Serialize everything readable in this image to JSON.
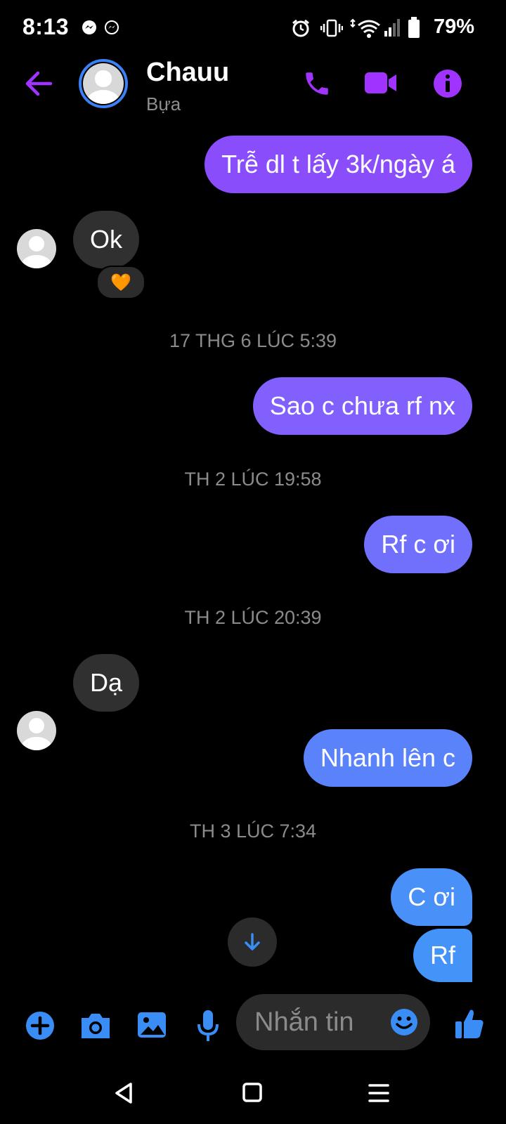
{
  "status_bar": {
    "time": "8:13",
    "battery": "79%"
  },
  "header": {
    "contact_name": "Chauu",
    "subtitle": "Bựa"
  },
  "messages": [
    {
      "dir": "out",
      "text": "Trễ dl t lấy 3k/ngày á",
      "color": "#8a4dfc"
    },
    {
      "dir": "in",
      "text": "Ok",
      "reaction": "🧡"
    },
    {
      "dir": "out",
      "text": "Sao c chưa rf nx",
      "color": "#8160fd"
    },
    {
      "dir": "out",
      "text": "Rf c ơi",
      "color": "#7070fd"
    },
    {
      "dir": "in",
      "text": "Dạ"
    },
    {
      "dir": "out",
      "text": "Nhanh lên c",
      "color": "#5a82fb"
    },
    {
      "dir": "out",
      "text": "C ơi",
      "color": "#4a90f9"
    },
    {
      "dir": "out",
      "text": "Rf",
      "color": "#4393f8"
    }
  ],
  "timestamps": [
    "17 THG 6 LÚC 5:39",
    "TH 2 LÚC 19:58",
    "TH 2 LÚC 20:39",
    "TH 3 LÚC 7:34"
  ],
  "composer": {
    "placeholder": "Nhắn tin"
  },
  "colors": {
    "accent_purple": "#a033ff",
    "accent_blue": "#3a8df5"
  },
  "icons": [
    "back-arrow-icon",
    "phone-icon",
    "video-call-icon",
    "info-icon",
    "heart-reaction-icon",
    "scroll-down-icon",
    "plus-icon",
    "camera-icon",
    "gallery-icon",
    "microphone-icon",
    "emoji-icon",
    "thumbs-up-icon",
    "nav-back-icon",
    "nav-home-icon",
    "nav-menu-icon"
  ]
}
